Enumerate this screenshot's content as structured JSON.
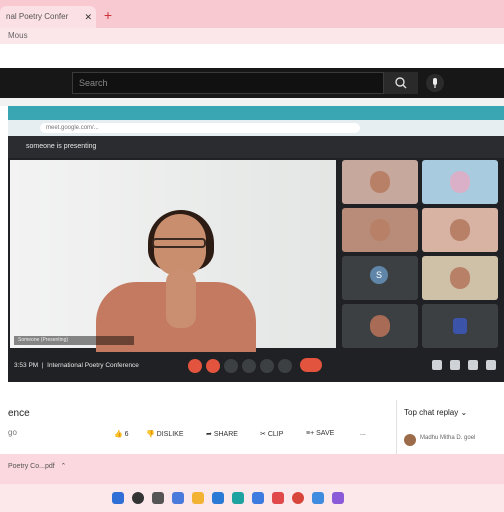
{
  "browser": {
    "tab_title": "nal Poetry Confer",
    "new_tab_icon": "plus-icon",
    "address_text": "Mous"
  },
  "youtube": {
    "search_placeholder": "Search",
    "search_icon": "search-icon",
    "mic_icon": "mic-icon"
  },
  "meet": {
    "url": "meet.google.com/...",
    "banner": "someone is presenting",
    "main_name": "Someone (Presenting)",
    "tiles": [
      "",
      "",
      "",
      "",
      "",
      "",
      "",
      ""
    ],
    "avatar_letter": "S",
    "time": "3:53 PM",
    "meeting_title": "International Poetry Conference"
  },
  "below_video": {
    "title": "ence",
    "subtitle": "go",
    "likes": "6",
    "dislike_label": "DISLIKE",
    "share_label": "SHARE",
    "clip_label": "CLIP",
    "save_label": "SAVE",
    "more_label": "..."
  },
  "chat": {
    "mode_label": "Top chat replay",
    "message_author": "Madhu Mitha D. goel"
  },
  "download": {
    "file_label": "Poetry Co...pdf"
  },
  "colors": {
    "accent_red": "#e2543d",
    "pink_chrome": "#f9c9d2",
    "meet_dark": "#202124"
  }
}
